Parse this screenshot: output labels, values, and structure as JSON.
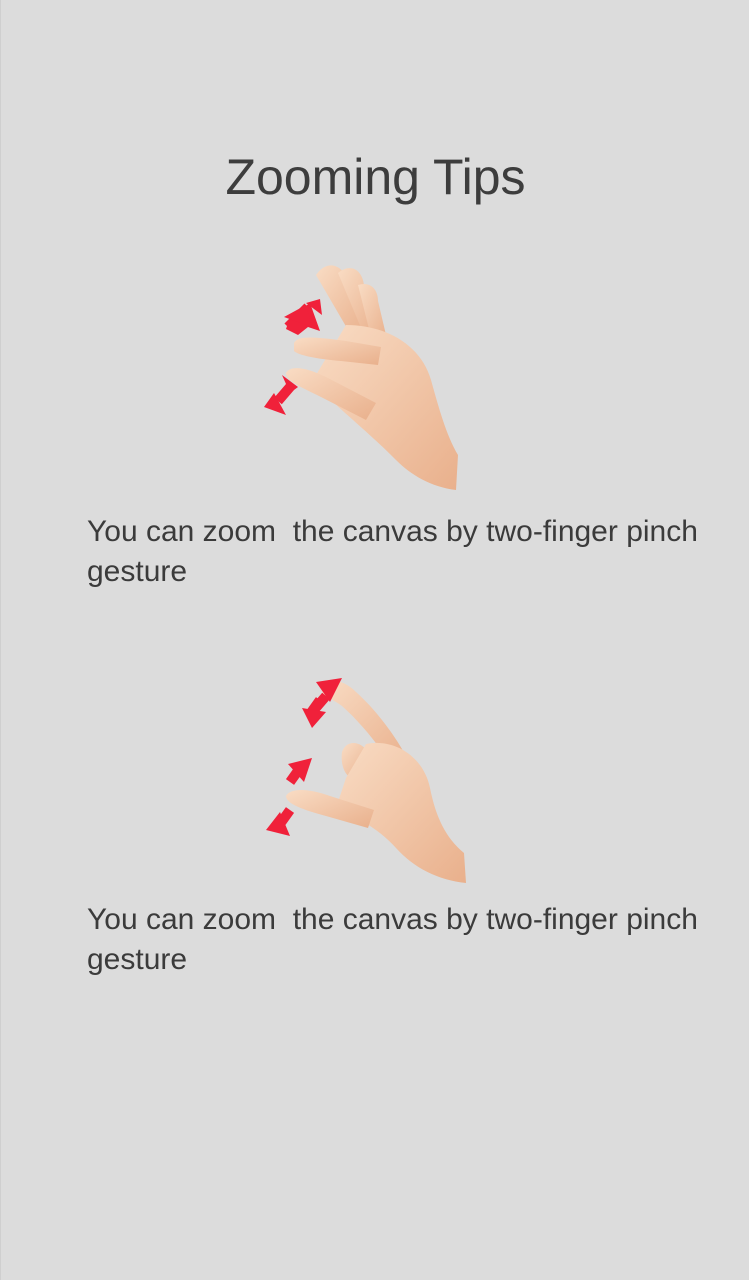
{
  "page": {
    "title": "Zooming Tips"
  },
  "tips": [
    {
      "text": "You can zoom  the canvas by two-finger pinch gesture",
      "illustration": "pinch-hand-icon"
    },
    {
      "text": "You can zoom  the canvas by two-finger pinch gesture",
      "illustration": "spread-hand-icon"
    }
  ],
  "colors": {
    "background": "#dcdcdc",
    "text": "#3b3b3b",
    "arrow": "#f0213a",
    "skin": "#f4c9a8"
  }
}
